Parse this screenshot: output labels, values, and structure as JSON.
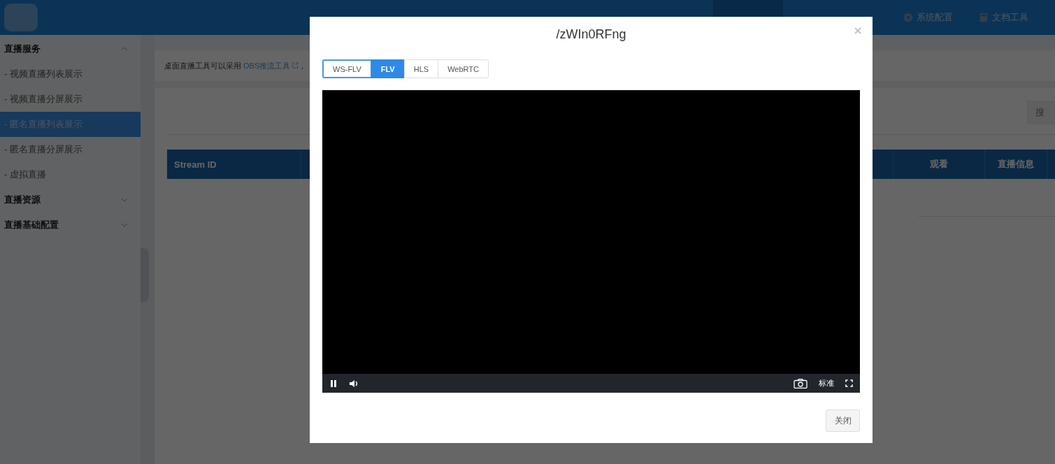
{
  "header": {
    "nav": [
      {
        "label": "系统配置",
        "kind": "settings"
      },
      {
        "label": "文档工具",
        "kind": "docs"
      }
    ]
  },
  "sidebar": {
    "groups": [
      {
        "label": "直播服务",
        "expanded": true,
        "items": [
          {
            "label": "- 视频直播列表展示",
            "selected": false
          },
          {
            "label": "- 视频直播分屏展示",
            "selected": false
          },
          {
            "label": "- 匿名直播列表展示",
            "selected": true
          },
          {
            "label": "- 匿名直播分屏展示",
            "selected": false
          },
          {
            "label": "- 虚拟直播",
            "selected": false
          }
        ]
      },
      {
        "label": "直播资源",
        "expanded": false
      },
      {
        "label": "直播基础配置",
        "expanded": false
      }
    ]
  },
  "notice": {
    "text": "桌面直播工具可以采用 ",
    "link": "OBS推流工具",
    "tail": "，"
  },
  "search_button": "搜",
  "table": {
    "columns": [
      "Stream ID",
      "观看",
      "直播信息"
    ]
  },
  "modal": {
    "title": "/zWIn0RFng",
    "tabs": [
      {
        "label": "WS-FLV",
        "selected": false,
        "focused": true
      },
      {
        "label": "FLV",
        "selected": true,
        "focused": false
      },
      {
        "label": "HLS",
        "selected": false,
        "focused": false
      },
      {
        "label": "WebRTC",
        "selected": false,
        "focused": false
      }
    ],
    "player": {
      "playing": true,
      "quality": "标准"
    },
    "close_button": "关闭"
  }
}
